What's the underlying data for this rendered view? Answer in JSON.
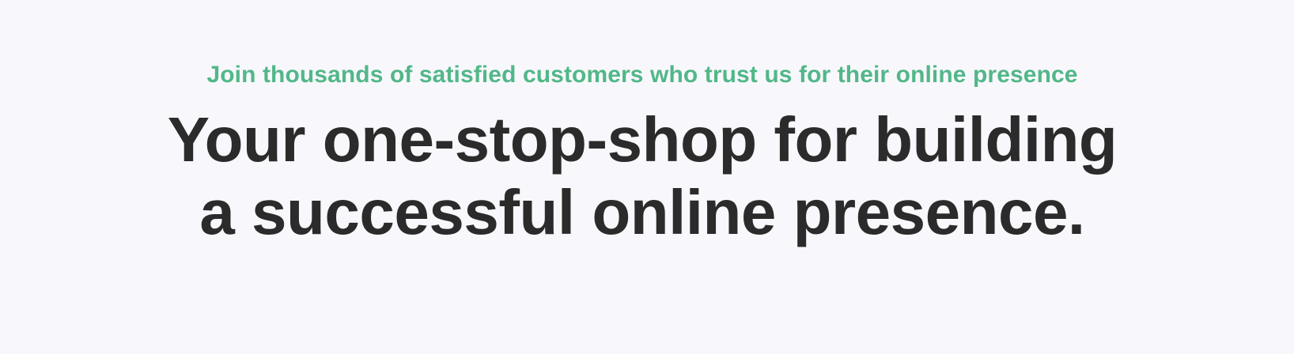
{
  "hero": {
    "eyebrow": "Join thousands of satisfied customers who trust us for their online presence",
    "headline_line1": "Your one-stop-shop for building",
    "headline_line2": "a successful online presence."
  },
  "colors": {
    "background": "#f8f8fc",
    "accent": "#52b788",
    "headline": "#2b2b2b"
  }
}
